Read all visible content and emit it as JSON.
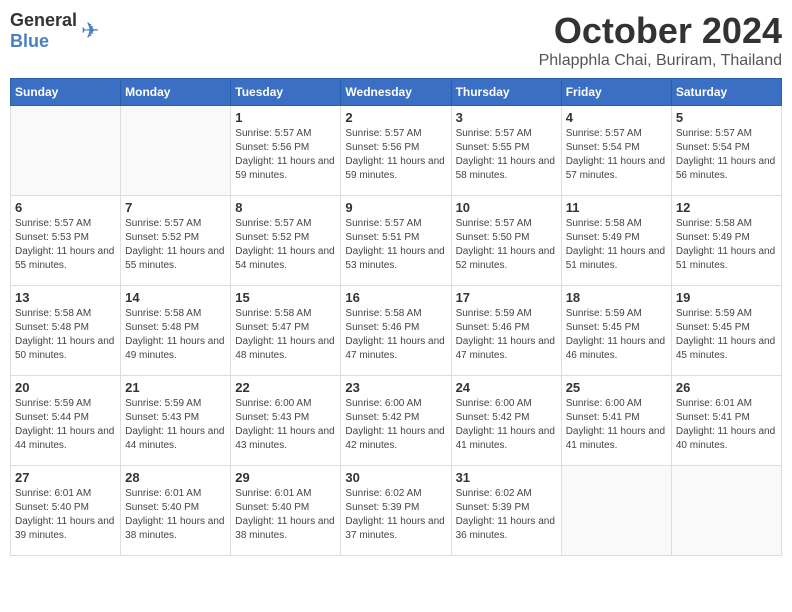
{
  "logo": {
    "general": "General",
    "blue": "Blue"
  },
  "title": "October 2024",
  "location": "Phlapphla Chai, Buriram, Thailand",
  "weekdays": [
    "Sunday",
    "Monday",
    "Tuesday",
    "Wednesday",
    "Thursday",
    "Friday",
    "Saturday"
  ],
  "weeks": [
    [
      {
        "day": "",
        "sunrise": "",
        "sunset": "",
        "daylight": ""
      },
      {
        "day": "",
        "sunrise": "",
        "sunset": "",
        "daylight": ""
      },
      {
        "day": "1",
        "sunrise": "Sunrise: 5:57 AM",
        "sunset": "Sunset: 5:56 PM",
        "daylight": "Daylight: 11 hours and 59 minutes."
      },
      {
        "day": "2",
        "sunrise": "Sunrise: 5:57 AM",
        "sunset": "Sunset: 5:56 PM",
        "daylight": "Daylight: 11 hours and 59 minutes."
      },
      {
        "day": "3",
        "sunrise": "Sunrise: 5:57 AM",
        "sunset": "Sunset: 5:55 PM",
        "daylight": "Daylight: 11 hours and 58 minutes."
      },
      {
        "day": "4",
        "sunrise": "Sunrise: 5:57 AM",
        "sunset": "Sunset: 5:54 PM",
        "daylight": "Daylight: 11 hours and 57 minutes."
      },
      {
        "day": "5",
        "sunrise": "Sunrise: 5:57 AM",
        "sunset": "Sunset: 5:54 PM",
        "daylight": "Daylight: 11 hours and 56 minutes."
      }
    ],
    [
      {
        "day": "6",
        "sunrise": "Sunrise: 5:57 AM",
        "sunset": "Sunset: 5:53 PM",
        "daylight": "Daylight: 11 hours and 55 minutes."
      },
      {
        "day": "7",
        "sunrise": "Sunrise: 5:57 AM",
        "sunset": "Sunset: 5:52 PM",
        "daylight": "Daylight: 11 hours and 55 minutes."
      },
      {
        "day": "8",
        "sunrise": "Sunrise: 5:57 AM",
        "sunset": "Sunset: 5:52 PM",
        "daylight": "Daylight: 11 hours and 54 minutes."
      },
      {
        "day": "9",
        "sunrise": "Sunrise: 5:57 AM",
        "sunset": "Sunset: 5:51 PM",
        "daylight": "Daylight: 11 hours and 53 minutes."
      },
      {
        "day": "10",
        "sunrise": "Sunrise: 5:57 AM",
        "sunset": "Sunset: 5:50 PM",
        "daylight": "Daylight: 11 hours and 52 minutes."
      },
      {
        "day": "11",
        "sunrise": "Sunrise: 5:58 AM",
        "sunset": "Sunset: 5:49 PM",
        "daylight": "Daylight: 11 hours and 51 minutes."
      },
      {
        "day": "12",
        "sunrise": "Sunrise: 5:58 AM",
        "sunset": "Sunset: 5:49 PM",
        "daylight": "Daylight: 11 hours and 51 minutes."
      }
    ],
    [
      {
        "day": "13",
        "sunrise": "Sunrise: 5:58 AM",
        "sunset": "Sunset: 5:48 PM",
        "daylight": "Daylight: 11 hours and 50 minutes."
      },
      {
        "day": "14",
        "sunrise": "Sunrise: 5:58 AM",
        "sunset": "Sunset: 5:48 PM",
        "daylight": "Daylight: 11 hours and 49 minutes."
      },
      {
        "day": "15",
        "sunrise": "Sunrise: 5:58 AM",
        "sunset": "Sunset: 5:47 PM",
        "daylight": "Daylight: 11 hours and 48 minutes."
      },
      {
        "day": "16",
        "sunrise": "Sunrise: 5:58 AM",
        "sunset": "Sunset: 5:46 PM",
        "daylight": "Daylight: 11 hours and 47 minutes."
      },
      {
        "day": "17",
        "sunrise": "Sunrise: 5:59 AM",
        "sunset": "Sunset: 5:46 PM",
        "daylight": "Daylight: 11 hours and 47 minutes."
      },
      {
        "day": "18",
        "sunrise": "Sunrise: 5:59 AM",
        "sunset": "Sunset: 5:45 PM",
        "daylight": "Daylight: 11 hours and 46 minutes."
      },
      {
        "day": "19",
        "sunrise": "Sunrise: 5:59 AM",
        "sunset": "Sunset: 5:45 PM",
        "daylight": "Daylight: 11 hours and 45 minutes."
      }
    ],
    [
      {
        "day": "20",
        "sunrise": "Sunrise: 5:59 AM",
        "sunset": "Sunset: 5:44 PM",
        "daylight": "Daylight: 11 hours and 44 minutes."
      },
      {
        "day": "21",
        "sunrise": "Sunrise: 5:59 AM",
        "sunset": "Sunset: 5:43 PM",
        "daylight": "Daylight: 11 hours and 44 minutes."
      },
      {
        "day": "22",
        "sunrise": "Sunrise: 6:00 AM",
        "sunset": "Sunset: 5:43 PM",
        "daylight": "Daylight: 11 hours and 43 minutes."
      },
      {
        "day": "23",
        "sunrise": "Sunrise: 6:00 AM",
        "sunset": "Sunset: 5:42 PM",
        "daylight": "Daylight: 11 hours and 42 minutes."
      },
      {
        "day": "24",
        "sunrise": "Sunrise: 6:00 AM",
        "sunset": "Sunset: 5:42 PM",
        "daylight": "Daylight: 11 hours and 41 minutes."
      },
      {
        "day": "25",
        "sunrise": "Sunrise: 6:00 AM",
        "sunset": "Sunset: 5:41 PM",
        "daylight": "Daylight: 11 hours and 41 minutes."
      },
      {
        "day": "26",
        "sunrise": "Sunrise: 6:01 AM",
        "sunset": "Sunset: 5:41 PM",
        "daylight": "Daylight: 11 hours and 40 minutes."
      }
    ],
    [
      {
        "day": "27",
        "sunrise": "Sunrise: 6:01 AM",
        "sunset": "Sunset: 5:40 PM",
        "daylight": "Daylight: 11 hours and 39 minutes."
      },
      {
        "day": "28",
        "sunrise": "Sunrise: 6:01 AM",
        "sunset": "Sunset: 5:40 PM",
        "daylight": "Daylight: 11 hours and 38 minutes."
      },
      {
        "day": "29",
        "sunrise": "Sunrise: 6:01 AM",
        "sunset": "Sunset: 5:40 PM",
        "daylight": "Daylight: 11 hours and 38 minutes."
      },
      {
        "day": "30",
        "sunrise": "Sunrise: 6:02 AM",
        "sunset": "Sunset: 5:39 PM",
        "daylight": "Daylight: 11 hours and 37 minutes."
      },
      {
        "day": "31",
        "sunrise": "Sunrise: 6:02 AM",
        "sunset": "Sunset: 5:39 PM",
        "daylight": "Daylight: 11 hours and 36 minutes."
      },
      {
        "day": "",
        "sunrise": "",
        "sunset": "",
        "daylight": ""
      },
      {
        "day": "",
        "sunrise": "",
        "sunset": "",
        "daylight": ""
      }
    ]
  ]
}
